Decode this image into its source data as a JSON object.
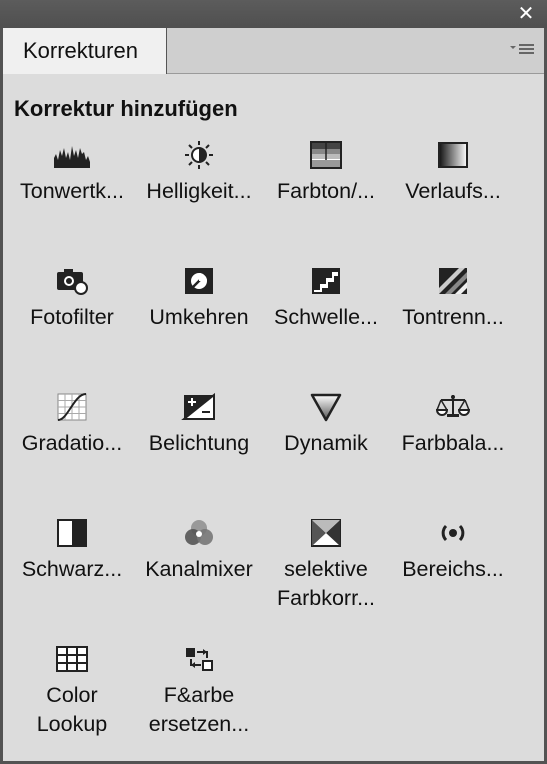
{
  "window": {
    "close_symbol": "✕"
  },
  "tab": {
    "label": "Korrekturen"
  },
  "section": {
    "title": "Korrektur hinzufügen"
  },
  "items": [
    {
      "label": "Tonwertk...",
      "icon": "levels-histogram-icon"
    },
    {
      "label": "Helligkeit...",
      "icon": "brightness-contrast-icon"
    },
    {
      "label": "Farbton/...",
      "icon": "hue-saturation-icon"
    },
    {
      "label": "Verlaufs...",
      "icon": "gradient-map-icon"
    },
    {
      "label": "Fotofilter",
      "icon": "photo-filter-icon"
    },
    {
      "label": "Umkehren",
      "icon": "invert-icon"
    },
    {
      "label": "Schwelle...",
      "icon": "threshold-icon"
    },
    {
      "label": "Tontrenn...",
      "icon": "posterize-icon"
    },
    {
      "label": "Gradatio...",
      "icon": "curves-icon"
    },
    {
      "label": "Belichtung",
      "icon": "exposure-icon"
    },
    {
      "label": "Dynamik",
      "icon": "vibrance-icon"
    },
    {
      "label": "Farbbala...",
      "icon": "color-balance-icon"
    },
    {
      "label": "Schwarz...",
      "icon": "black-white-icon"
    },
    {
      "label": "Kanalmixer",
      "icon": "channel-mixer-icon"
    },
    {
      "label_line1": "selektive",
      "label_line2": "Farbkorr...",
      "icon": "selective-color-icon"
    },
    {
      "label": "Bereichs...",
      "icon": "color-range-icon"
    },
    {
      "label_line1": "Color",
      "label_line2": "Lookup",
      "icon": "color-lookup-icon"
    },
    {
      "label_line1": "F&arbe",
      "label_line2": "ersetzen...",
      "icon": "replace-color-icon"
    }
  ]
}
